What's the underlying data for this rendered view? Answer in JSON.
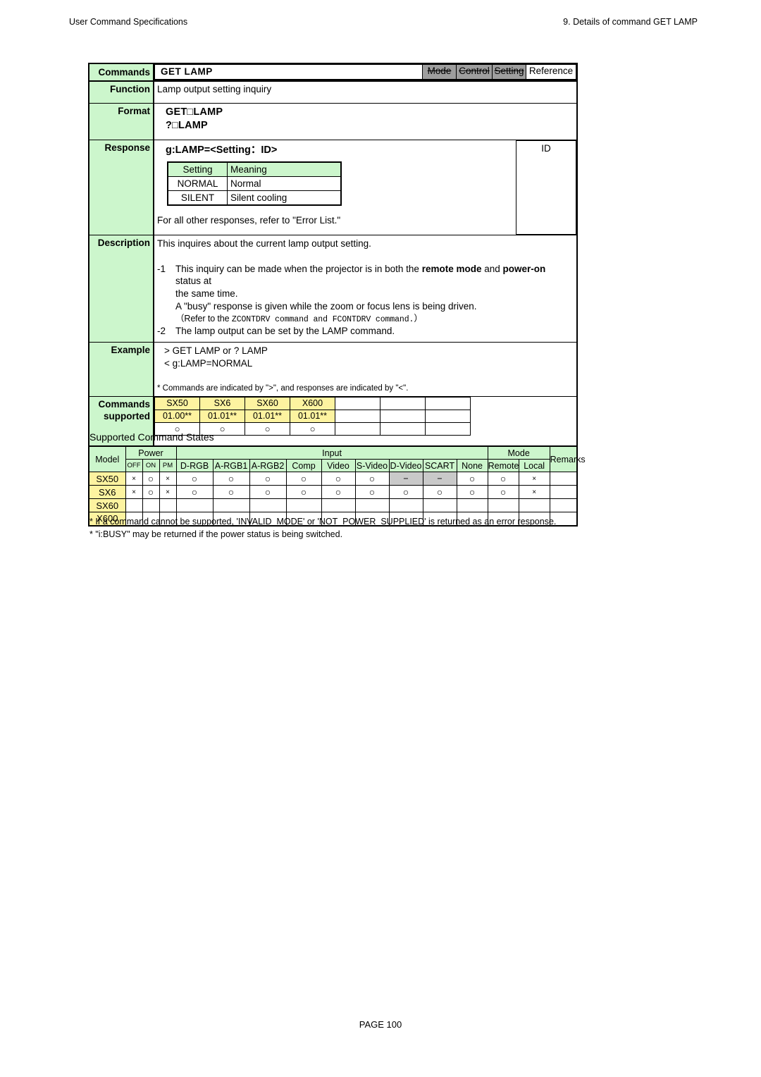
{
  "header": {
    "left": "User Command Specifications",
    "right": "9. Details of command  GET LAMP"
  },
  "command_table": {
    "labels": {
      "commands": "Commands",
      "function": "Function",
      "format": "Format",
      "response": "Response",
      "description": "Description",
      "example": "Example",
      "commands_supported_line1": "Commands",
      "commands_supported_line2": "supported"
    },
    "title": "GET LAMP",
    "flags": [
      {
        "label": "Mode",
        "state": "disabled"
      },
      {
        "label": "Control",
        "state": "disabled"
      },
      {
        "label": "Setting",
        "state": "disabled"
      },
      {
        "label": "Reference",
        "state": "active"
      }
    ],
    "function_text": "Lamp output setting inquiry",
    "format_lines": [
      "GET□LAMP",
      "?□LAMP"
    ],
    "response": {
      "syntax": "g:LAMP=<Setting：ID>",
      "subtable": {
        "headers": [
          "Setting",
          "Meaning"
        ],
        "rows": [
          {
            "setting": "NORMAL",
            "meaning": "Normal"
          },
          {
            "setting": "SILENT",
            "meaning": "Silent cooling"
          }
        ]
      },
      "note": "For all other responses, refer to \"Error List.\"",
      "id_column": "ID"
    },
    "description": {
      "intro": "This inquires about the current lamp output setting.",
      "items": [
        {
          "num": "-1",
          "lines": [
            "This inquiry can be made when the projector is in both the remote mode and power-on status at the same time.",
            "A \"busy\" response is given while the zoom or focus lens is being driven."
          ],
          "refer": "（Refer to the ZCONTDRV command and FCONTDRV command.）",
          "bold_terms": [
            "remote mode",
            "power-on"
          ]
        },
        {
          "num": "-2",
          "lines": [
            "The lamp output can be set by the LAMP command."
          ]
        }
      ]
    },
    "example": {
      "lines": [
        "> GET LAMP or ? LAMP",
        "< g:LAMP=NORMAL"
      ],
      "note": "* Commands are indicated by \">\", and responses are indicated by \"<\"."
    },
    "supported": {
      "columns": [
        {
          "model": "SX50",
          "version": "01.00**",
          "mark": "○"
        },
        {
          "model": "SX6",
          "version": "01.01**",
          "mark": "○"
        },
        {
          "model": "SX60",
          "version": "01.01**",
          "mark": "○"
        },
        {
          "model": "X600",
          "version": "01.01**",
          "mark": "○"
        },
        {
          "model": "",
          "version": "",
          "mark": ""
        },
        {
          "model": "",
          "version": "",
          "mark": ""
        },
        {
          "model": "",
          "version": "",
          "mark": ""
        }
      ]
    }
  },
  "states_table": {
    "title": "Supported Command States",
    "group_headers": {
      "model": "Model",
      "power": "Power",
      "input": "Input",
      "mode": "Mode",
      "remarks": "Remarks"
    },
    "sub_headers": {
      "power": [
        "OFF",
        "ON",
        "PM"
      ],
      "input": [
        "D-RGB",
        "A-RGB1",
        "A-RGB2",
        "Comp",
        "Video",
        "S-Video",
        "D-Video",
        "SCART",
        "None"
      ],
      "mode": [
        "Remote",
        "Local"
      ]
    },
    "rows": [
      {
        "models": [
          "SX50"
        ],
        "power": [
          "×",
          "○",
          "×"
        ],
        "input": [
          "○",
          "○",
          "○",
          "○",
          "○",
          "○",
          "−",
          "−",
          "○"
        ],
        "input_disabled": [
          false,
          false,
          false,
          false,
          false,
          false,
          true,
          true,
          false
        ],
        "mode": [
          "○",
          "×"
        ],
        "remarks": ""
      },
      {
        "models": [
          "SX6",
          "SX60",
          "X600"
        ],
        "power": [
          "×",
          "○",
          "×"
        ],
        "input": [
          "○",
          "○",
          "○",
          "○",
          "○",
          "○",
          "○",
          "○",
          "○"
        ],
        "input_disabled": [
          false,
          false,
          false,
          false,
          false,
          false,
          false,
          false,
          false
        ],
        "mode": [
          "○",
          "×"
        ],
        "remarks": ""
      }
    ]
  },
  "footnotes": [
    "* If a command cannot be supported, 'INVALID_MODE' or 'NOT_POWER_SUPPLIED' is returned as an error response.",
    "* \"i:BUSY\" may be returned if the power status is being switched."
  ],
  "page_footer": "PAGE 100",
  "colors": {
    "label_green": "#ccf6cc",
    "model_yellow": "#fdf3a0",
    "disabled_grey": "#9e9e9e",
    "cell_grey": "#c9c9c9"
  }
}
